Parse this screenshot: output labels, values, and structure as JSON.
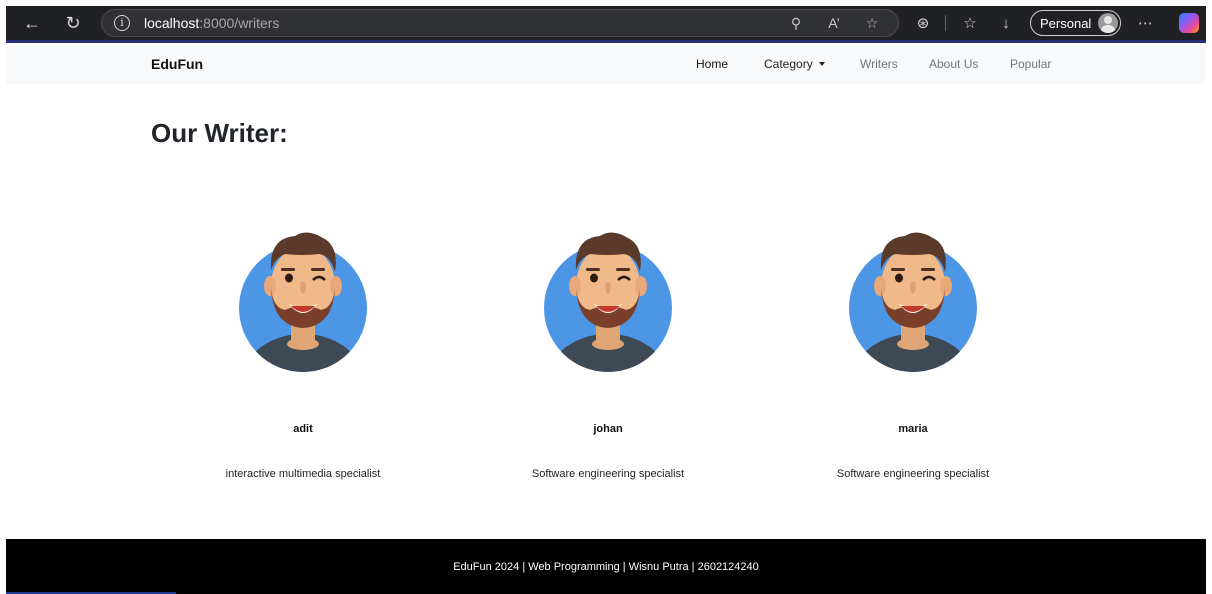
{
  "browser": {
    "url_host": "localhost",
    "url_path": ":8000/writers",
    "profile_label": "Personal"
  },
  "navbar": {
    "brand": "EduFun",
    "links": [
      {
        "label": "Home"
      },
      {
        "label": "Category"
      },
      {
        "label": "Writers"
      },
      {
        "label": "About Us"
      },
      {
        "label": "Popular"
      }
    ]
  },
  "main": {
    "title": "Our Writer:",
    "writers": [
      {
        "name": "adit",
        "role": "interactive multimedia specialist"
      },
      {
        "name": "johan",
        "role": "Software engineering specialist"
      },
      {
        "name": "maria",
        "role": "Software engineering specialist"
      }
    ]
  },
  "footer": {
    "text": "EduFun 2024 | Web Programming | Wisnu Putra | 2602124240"
  },
  "colors": {
    "avatar_bg": "#4d96e6",
    "shirt": "#3d4a55",
    "hair": "#5a3a2a",
    "skin": "#f0b98a",
    "browser_bar": "#202124",
    "navbar_bg": "#f8f9fa",
    "footer_bg": "#000000"
  }
}
